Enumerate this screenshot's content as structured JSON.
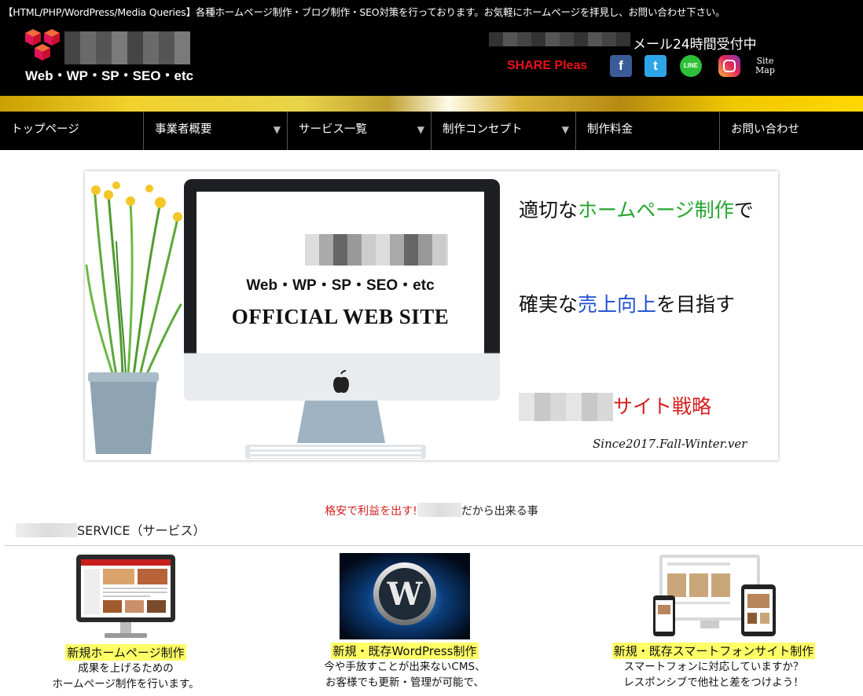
{
  "header": {
    "tagline": "【HTML/PHP/WordPress/Media Queries】各種ホームページ制作・ブログ制作・SEO対策を行っております。お気軽にホームページを拝見し、お問い合わせ下さい。",
    "logo_sub": "Web・WP・SP・SEO・etc",
    "mail_text": "メール24時間受付中",
    "share_label": "SHARE Pleas",
    "sitemap": "Site\nMap"
  },
  "nav": {
    "items": [
      {
        "label": "トップページ",
        "arrow": ""
      },
      {
        "label": "事業者概要",
        "arrow": "▼"
      },
      {
        "label": "サービス一覧",
        "arrow": "▼"
      },
      {
        "label": "制作コンセプト",
        "arrow": "▼"
      },
      {
        "label": "制作料金",
        "arrow": ""
      },
      {
        "label": "お問い合わせ",
        "arrow": ""
      }
    ]
  },
  "hero": {
    "screen_sub": "Web・WP・SP・SEO・etc",
    "screen_title": "OFFICIAL WEB SITE",
    "line1_pre": "適切な",
    "line1_green": "ホームページ制作",
    "line1_post": "で",
    "line2_pre": "確実な",
    "line2_blue": "売上向上",
    "line2_post": "を目指す",
    "strategy": "サイト戦略",
    "since": "Since2017.Fall-Winter.ver"
  },
  "services": {
    "intro_red": "格安で利益を出す!",
    "intro_rest": "だから出来る事",
    "heading": "SERVICE（サービス）",
    "items": [
      {
        "title": "新規ホームページ制作",
        "desc1": "成果を上げるための",
        "desc2": "ホームページ制作を行います。"
      },
      {
        "title": "新規・既存WordPress制作",
        "desc1": "今や手放すことが出来ないCMS、",
        "desc2": "お客様でも更新・管理が可能で、"
      },
      {
        "title": "新規・既存スマートフォンサイト制作",
        "desc1": "スマートフォンに対応していますか？",
        "desc2": "レスポンシブで他社と差をつけよう！"
      }
    ]
  },
  "colors": {
    "brand_red": "#d42020",
    "green": "#25a52e",
    "blue": "#1f4fd0",
    "highlight": "#ffff66",
    "gold": "#f2d12d"
  },
  "icons": [
    "facebook-icon",
    "twitter-icon",
    "line-icon",
    "instagram-icon",
    "apple-logo-icon",
    "wordpress-logo-icon"
  ]
}
